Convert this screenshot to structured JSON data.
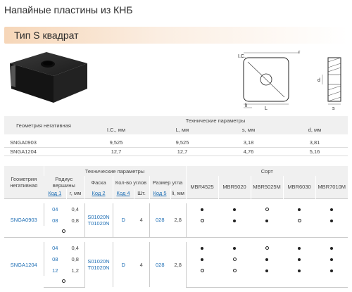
{
  "page": {
    "title": "Напайные пластины из КНБ"
  },
  "banner": {
    "label": "Тип S квадрат"
  },
  "drawing": {
    "labels": {
      "ic": "I.C.",
      "r": "r",
      "d": "d",
      "l": "L",
      "li": "li",
      "s": "s"
    }
  },
  "table1": {
    "col_geometry": "Геометрия негативная",
    "group_header": "Технические параметры",
    "cols": [
      "I.C., мм",
      "L, мм",
      "s, мм",
      "d, мм"
    ],
    "rows": [
      {
        "name": "SNGA0903",
        "values": [
          "9,525",
          "9,525",
          "3,18",
          "3,81"
        ]
      },
      {
        "name": "SNGA1204",
        "values": [
          "12,7",
          "12,7",
          "4,76",
          "5,16"
        ]
      }
    ]
  },
  "table2": {
    "col_geometry": "Геометрия негативная",
    "group_tech": "Технические параметры",
    "group_grade": "Сорт",
    "sub_radius": "Радиус вершины",
    "sub_chamfer": "Фаска",
    "sub_corners": "Кол-во углов",
    "sub_angle": "Размер угла",
    "code1": "Код 1",
    "r_mm": "r, мм",
    "code2": "Код 2",
    "code4": "Код 4",
    "pcs": "Шт.",
    "code5": "Код 5",
    "li_mm": "li, мм",
    "grades": [
      "MBR4525",
      "MBR5020",
      "MBR5025M",
      "MBR6030",
      "MBR7010M"
    ],
    "blocks": [
      {
        "name": "SNGA0903",
        "radius_rows": [
          {
            "code": "04",
            "r": "0,4",
            "grades": [
              "filled",
              "filled",
              "open",
              "filled",
              "filled"
            ]
          },
          {
            "code": "08",
            "r": "0,8",
            "grades": [
              "open",
              "filled",
              "filled",
              "open",
              "filled"
            ]
          },
          {
            "code": "",
            "r": "",
            "grades": [
              "",
              "",
              "",
              "",
              ""
            ],
            "marker": "open"
          }
        ],
        "chamfer": [
          "S01020N",
          "T01020N"
        ],
        "corner_code": "D",
        "corner_count": "4",
        "angle_code": "028",
        "li": "2,8"
      },
      {
        "name": "SNGA1204",
        "radius_rows": [
          {
            "code": "04",
            "r": "0,4",
            "grades": [
              "filled",
              "filled",
              "open",
              "filled",
              "filled"
            ]
          },
          {
            "code": "08",
            "r": "0,8",
            "grades": [
              "filled",
              "open",
              "filled",
              "filled",
              "filled"
            ]
          },
          {
            "code": "12",
            "r": "1,2",
            "grades": [
              "open",
              "open",
              "filled",
              "filled",
              "filled"
            ]
          },
          {
            "code": "",
            "r": "",
            "grades": [
              "",
              "",
              "",
              "",
              ""
            ],
            "marker": "open"
          }
        ],
        "chamfer": [
          "S01020N",
          "T01020N"
        ],
        "corner_code": "D",
        "corner_count": "4",
        "angle_code": "028",
        "li": "2,8"
      }
    ]
  }
}
